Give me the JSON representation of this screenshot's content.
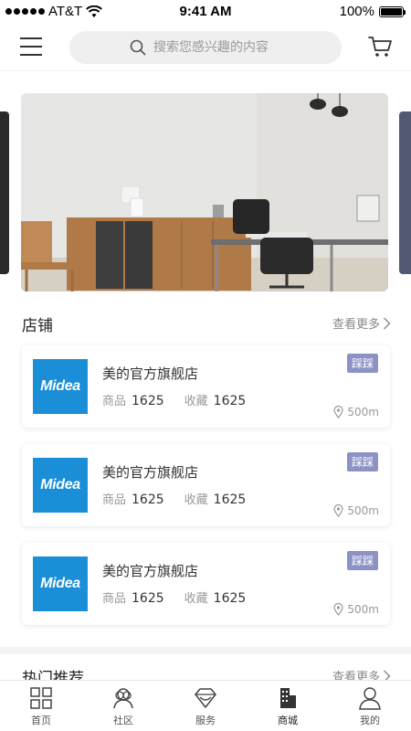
{
  "status_bar": {
    "carrier": "AT&T",
    "time": "9:41 AM",
    "battery": "100%"
  },
  "header": {
    "search_placeholder": "搜索您感兴趣的内容"
  },
  "stores_section": {
    "title": "店铺",
    "more": "查看更多"
  },
  "stores": [
    {
      "logo_text": "Midea",
      "name": "美的官方旗舰店",
      "goods_label": "商品",
      "goods_count": "1625",
      "fav_label": "收藏",
      "fav_count": "1625",
      "badge": "踩踩",
      "distance": "500m"
    },
    {
      "logo_text": "Midea",
      "name": "美的官方旗舰店",
      "goods_label": "商品",
      "goods_count": "1625",
      "fav_label": "收藏",
      "fav_count": "1625",
      "badge": "踩踩",
      "distance": "500m"
    },
    {
      "logo_text": "Midea",
      "name": "美的官方旗舰店",
      "goods_label": "商品",
      "goods_count": "1625",
      "fav_label": "收藏",
      "fav_count": "1625",
      "badge": "踩踩",
      "distance": "500m"
    }
  ],
  "hot_section": {
    "title": "热门推荐",
    "more": "查看更多"
  },
  "tabs": [
    {
      "label": "首页",
      "icon": "grid-icon"
    },
    {
      "label": "社区",
      "icon": "community-icon"
    },
    {
      "label": "服务",
      "icon": "diamond-icon"
    },
    {
      "label": "商城",
      "icon": "building-icon"
    },
    {
      "label": "我的",
      "icon": "person-icon"
    }
  ],
  "colors": {
    "badge": "#8d92c5",
    "logo": "#1a8ed6",
    "search_bg": "#efefef"
  }
}
